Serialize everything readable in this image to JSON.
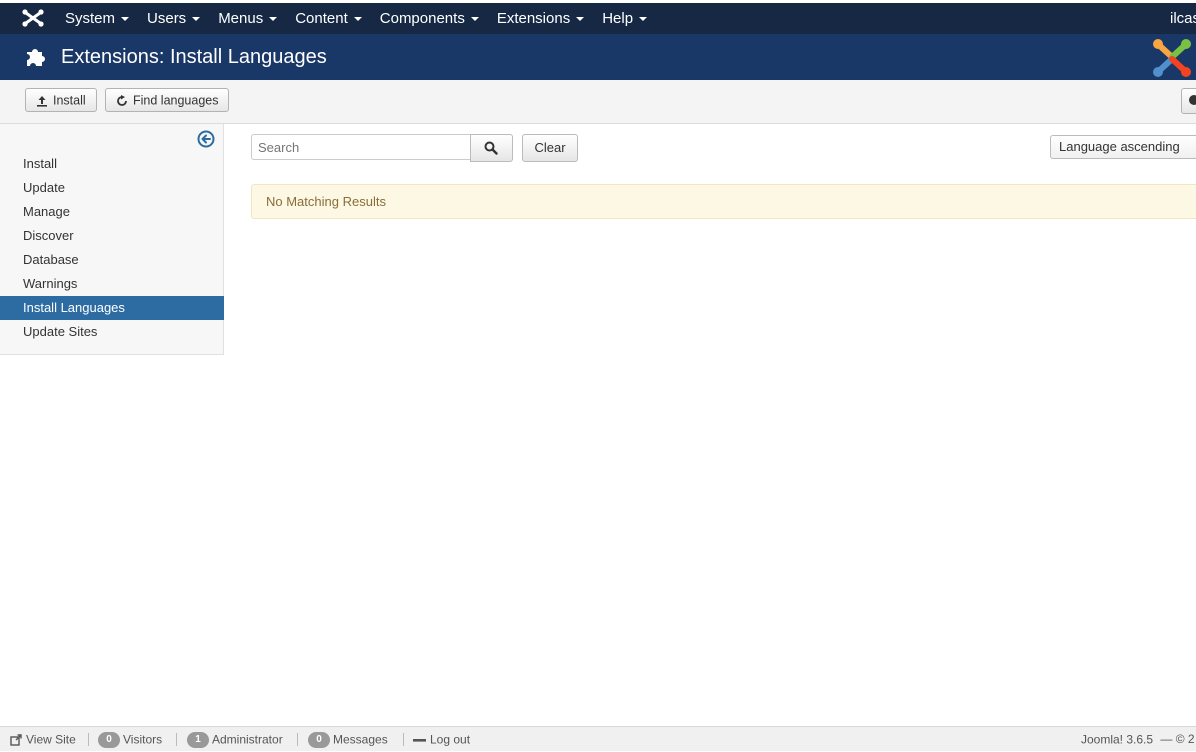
{
  "navbar": {
    "brand_icon": "joomla-icon",
    "menu": [
      {
        "label": "System"
      },
      {
        "label": "Users"
      },
      {
        "label": "Menus"
      },
      {
        "label": "Content"
      },
      {
        "label": "Components"
      },
      {
        "label": "Extensions"
      },
      {
        "label": "Help"
      }
    ],
    "user": "ilcas"
  },
  "header": {
    "icon": "puzzle-icon",
    "title": "Extensions: Install Languages",
    "logo": "joomla-logo"
  },
  "toolbar": {
    "install_label": "Install",
    "find_languages_label": "Find languages"
  },
  "sidebar": {
    "items": [
      {
        "label": "Install"
      },
      {
        "label": "Update"
      },
      {
        "label": "Manage"
      },
      {
        "label": "Discover"
      },
      {
        "label": "Database"
      },
      {
        "label": "Warnings"
      },
      {
        "label": "Install Languages",
        "active": true
      },
      {
        "label": "Update Sites"
      }
    ]
  },
  "filters": {
    "search_placeholder": "Search",
    "clear_label": "Clear",
    "sort_value": "Language ascending"
  },
  "message": "No Matching Results",
  "statusbar": {
    "view_site": "View Site",
    "visitors_count": "0",
    "visitors_label": "Visitors",
    "admin_count": "1",
    "admin_label": "Administrator",
    "messages_count": "0",
    "messages_label": "Messages",
    "logout": "Log out",
    "version": "Joomla! 3.6.5",
    "copyright": "— © 2"
  },
  "colors": {
    "navbar": "#172845",
    "header": "#1a3867",
    "active_item": "#2d6ca2",
    "alert_bg": "#fcf8e3",
    "alert_text": "#8a6d3b"
  }
}
